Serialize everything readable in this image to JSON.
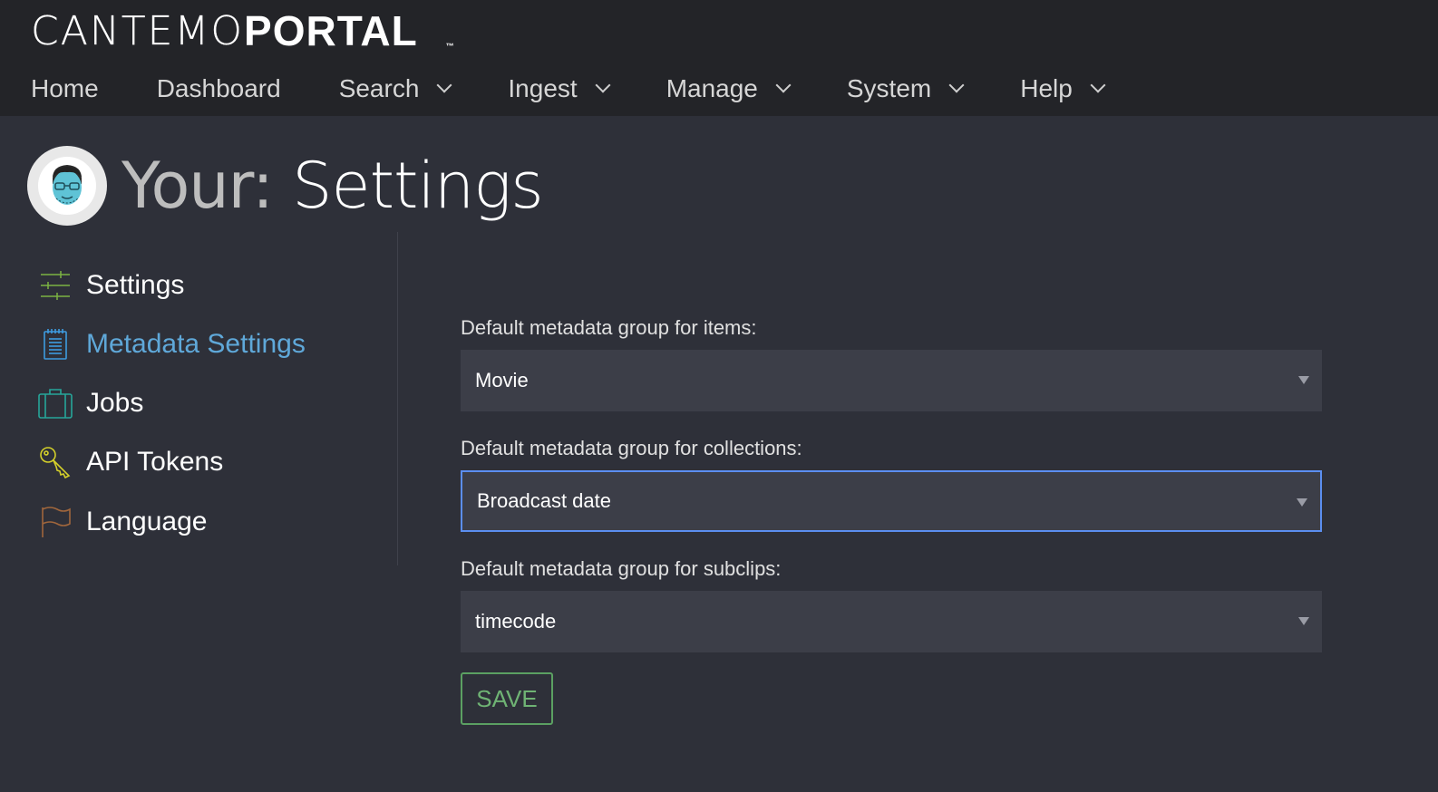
{
  "brand": {
    "logo_left": "CANTEMO",
    "logo_right": "PORTAL",
    "trademark": "™"
  },
  "nav": {
    "items": [
      {
        "label": "Home",
        "dropdown": false
      },
      {
        "label": "Dashboard",
        "dropdown": false
      },
      {
        "label": "Search",
        "dropdown": true
      },
      {
        "label": "Ingest",
        "dropdown": true
      },
      {
        "label": "Manage",
        "dropdown": true
      },
      {
        "label": "System",
        "dropdown": true
      },
      {
        "label": "Help",
        "dropdown": true
      }
    ]
  },
  "page": {
    "title_prefix": "Your:",
    "title": "Settings"
  },
  "sidebar": {
    "items": [
      {
        "label": "Settings",
        "icon": "sliders-icon",
        "active": false
      },
      {
        "label": "Metadata Settings",
        "icon": "notepad-icon",
        "active": true
      },
      {
        "label": "Jobs",
        "icon": "briefcase-icon",
        "active": false
      },
      {
        "label": "API Tokens",
        "icon": "key-icon",
        "active": false
      },
      {
        "label": "Language",
        "icon": "flag-icon",
        "active": false
      }
    ]
  },
  "form": {
    "items_label": "Default metadata group for items:",
    "items_value": "Movie",
    "collections_label": "Default metadata group for collections:",
    "collections_value": "Broadcast date",
    "subclips_label": "Default metadata group for subclips:",
    "subclips_value": "timecode",
    "save_label": "SAVE"
  },
  "colors": {
    "topbar": "#232428",
    "background": "#2e3039",
    "active_link": "#5fa8d9",
    "focus_border": "#5b8ef0",
    "save_green": "#6fb374"
  }
}
